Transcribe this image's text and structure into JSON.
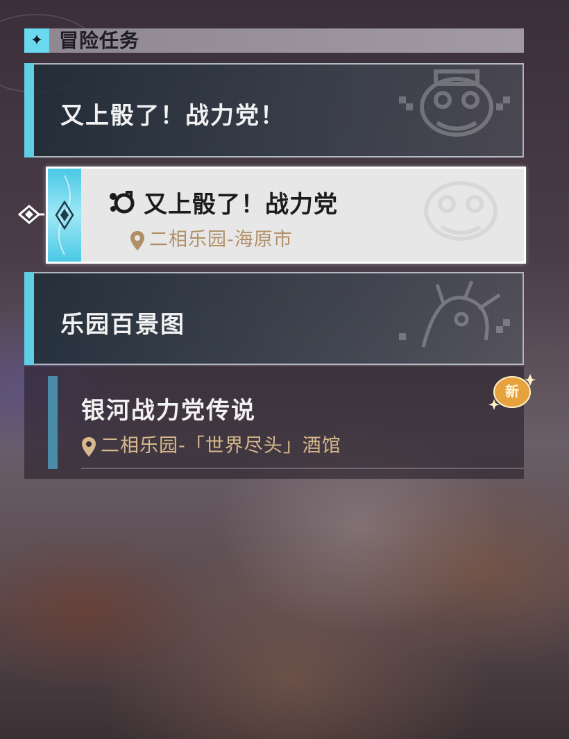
{
  "header": {
    "title": "冒险任务",
    "icon": "sparkle-icon"
  },
  "categories": [
    {
      "title": "又上骰了！战力党！"
    },
    {
      "title": "乐园百景图"
    }
  ],
  "quests": [
    {
      "title": "又上骰了！战力党",
      "location": "二相乐园-海原市",
      "selected": true,
      "icon": "dice-quest-icon"
    },
    {
      "title": "银河战力党传说",
      "location": "二相乐园-「世界尽头」酒馆",
      "badge": "新"
    }
  ],
  "colors": {
    "accent": "#5ecfe4",
    "location": "#b18f66",
    "badge": "#e6a23c"
  }
}
